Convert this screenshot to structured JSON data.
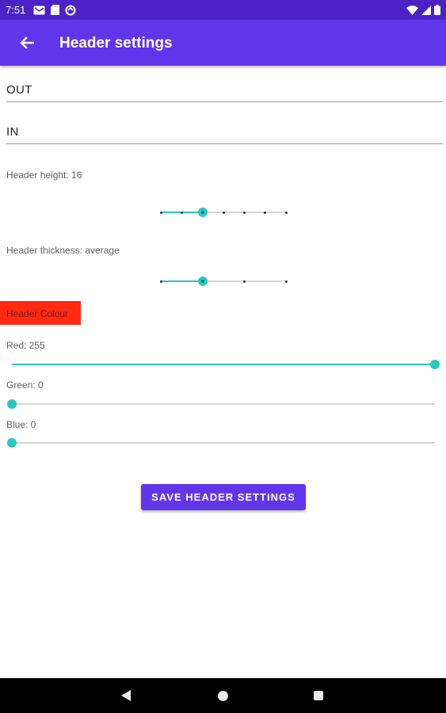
{
  "status_bar": {
    "time": "7:51",
    "left_icons": [
      "mail-icon",
      "sd-card-icon",
      "sync-icon"
    ],
    "right_icons": [
      "wifi-icon",
      "signal-icon",
      "battery-icon"
    ]
  },
  "app_bar": {
    "title": "Header settings",
    "back_icon": "arrow-back-icon"
  },
  "fields": {
    "out_value": "OUT",
    "in_value": "IN"
  },
  "header_height": {
    "label": "Header height: 16",
    "steps": 7,
    "selected_index": 2
  },
  "header_thickness": {
    "label": "Header thickness: average",
    "steps": 4,
    "selected_index": 1
  },
  "header_colour": {
    "label": "Header Colour",
    "swatch_color": "#ff2a12"
  },
  "rgb": {
    "red_label": "Red: 255",
    "red_value": 255,
    "green_label": "Green: 0",
    "green_value": 0,
    "blue_label": "Blue: 0",
    "blue_value": 0,
    "max": 255
  },
  "save_button": "SAVE HEADER SETTINGS",
  "colors": {
    "primary": "#6036ea",
    "status_bar": "#4a22c6",
    "accent": "#2bc8bd"
  }
}
